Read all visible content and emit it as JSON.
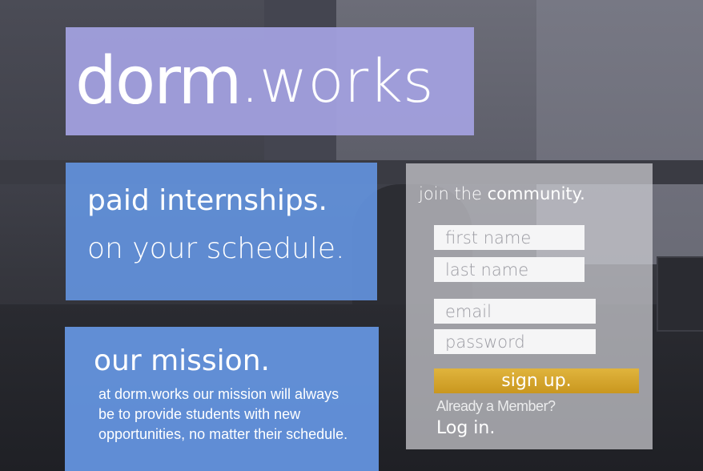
{
  "brand": {
    "name_bold": "dorm",
    "name_light": ".works",
    "background_color": "#a2a0de"
  },
  "tagline": {
    "line1": "paid internships.",
    "line2": "on your schedule."
  },
  "mission": {
    "title": "our mission.",
    "body": "at dorm.works our mission will always be to provide students with new opportunities, no matter their schedule."
  },
  "signup": {
    "heading_light": "join the ",
    "heading_bold": "community.",
    "fields": {
      "first_name_placeholder": "first name",
      "last_name_placeholder": "last name",
      "email_placeholder": "email",
      "password_placeholder": "password"
    },
    "button_label": "sign up.",
    "already_member": "Already a Member?",
    "login_label": "Log in."
  },
  "colors": {
    "card_blue": "#6392dd",
    "signup_gold": "#d6a72e",
    "panel_gray": "#cdcdd2"
  }
}
